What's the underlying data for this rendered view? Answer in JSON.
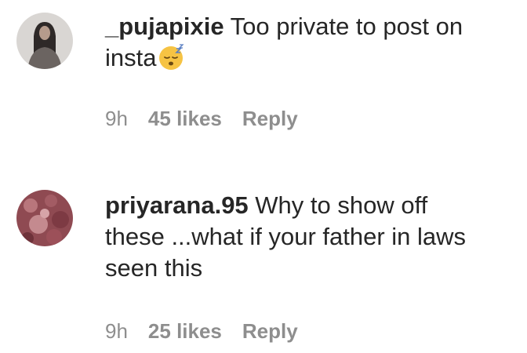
{
  "comments": [
    {
      "username": "_pujapixie",
      "text_line1": "Too private to post on",
      "text_line2": "insta",
      "emoji_icon": "sleeping-face-icon",
      "time": "9h",
      "likes": "45 likes",
      "reply": "Reply"
    },
    {
      "username": "priyarana.95",
      "text_line1": "Why to show off",
      "text_line2": "these ...what if your father in laws",
      "text_line3": "seen this",
      "time": "9h",
      "likes": "25 likes",
      "reply": "Reply"
    }
  ],
  "colors": {
    "text": "#262626",
    "meta": "#8e8e8e",
    "background": "#ffffff"
  }
}
